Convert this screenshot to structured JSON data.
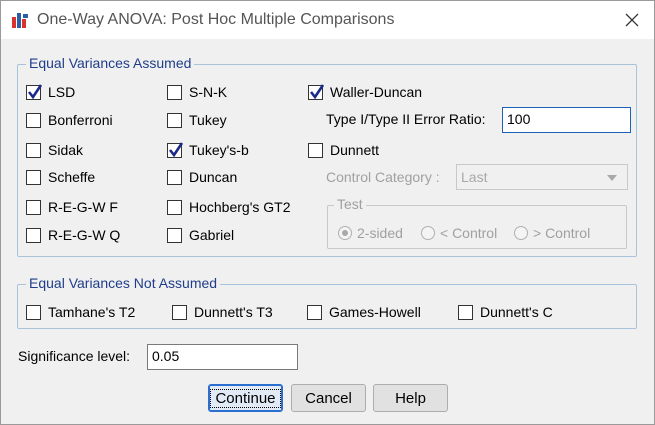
{
  "window": {
    "title": "One-Way ANOVA: Post Hoc Multiple Comparisons"
  },
  "equal_variances_assumed": {
    "legend": "Equal Variances Assumed",
    "col1": [
      {
        "label": "LSD",
        "checked": true
      },
      {
        "label": "Bonferroni",
        "checked": false
      },
      {
        "label": "Sidak",
        "checked": false
      },
      {
        "label": "Scheffe",
        "checked": false
      },
      {
        "label": "R-E-G-W F",
        "checked": false
      },
      {
        "label": "R-E-G-W Q",
        "checked": false
      }
    ],
    "col2": [
      {
        "label": "S-N-K",
        "checked": false
      },
      {
        "label": "Tukey",
        "checked": false
      },
      {
        "label": "Tukey's-b",
        "checked": true
      },
      {
        "label": "Duncan",
        "checked": false
      },
      {
        "label": "Hochberg's GT2",
        "checked": false
      },
      {
        "label": "Gabriel",
        "checked": false
      }
    ],
    "waller_duncan": {
      "label": "Waller-Duncan",
      "checked": true
    },
    "error_ratio_label": "Type I/Type II Error Ratio:",
    "error_ratio_value": "100",
    "dunnett": {
      "label": "Dunnett",
      "checked": false
    },
    "control_category_label": "Control Category :",
    "control_category_value": "Last",
    "test": {
      "legend": "Test",
      "options": [
        {
          "label": "2-sided",
          "selected": true
        },
        {
          "label": "< Control",
          "selected": false
        },
        {
          "label": "> Control",
          "selected": false
        }
      ]
    }
  },
  "equal_variances_not_assumed": {
    "legend": "Equal Variances Not Assumed",
    "items": [
      {
        "label": "Tamhane's T2",
        "checked": false
      },
      {
        "label": "Dunnett's T3",
        "checked": false
      },
      {
        "label": "Games-Howell",
        "checked": false
      },
      {
        "label": "Dunnett's C",
        "checked": false
      }
    ]
  },
  "significance": {
    "label": "Significance level:",
    "value": "0.05"
  },
  "buttons": {
    "continue": "Continue",
    "cancel": "Cancel",
    "help": "Help"
  },
  "colors": {
    "legend_text": "#1f3d8a",
    "group_border": "#a9c3dc",
    "default_button_border": "#2a6fd0",
    "disabled_text": "#a0a0a0"
  }
}
